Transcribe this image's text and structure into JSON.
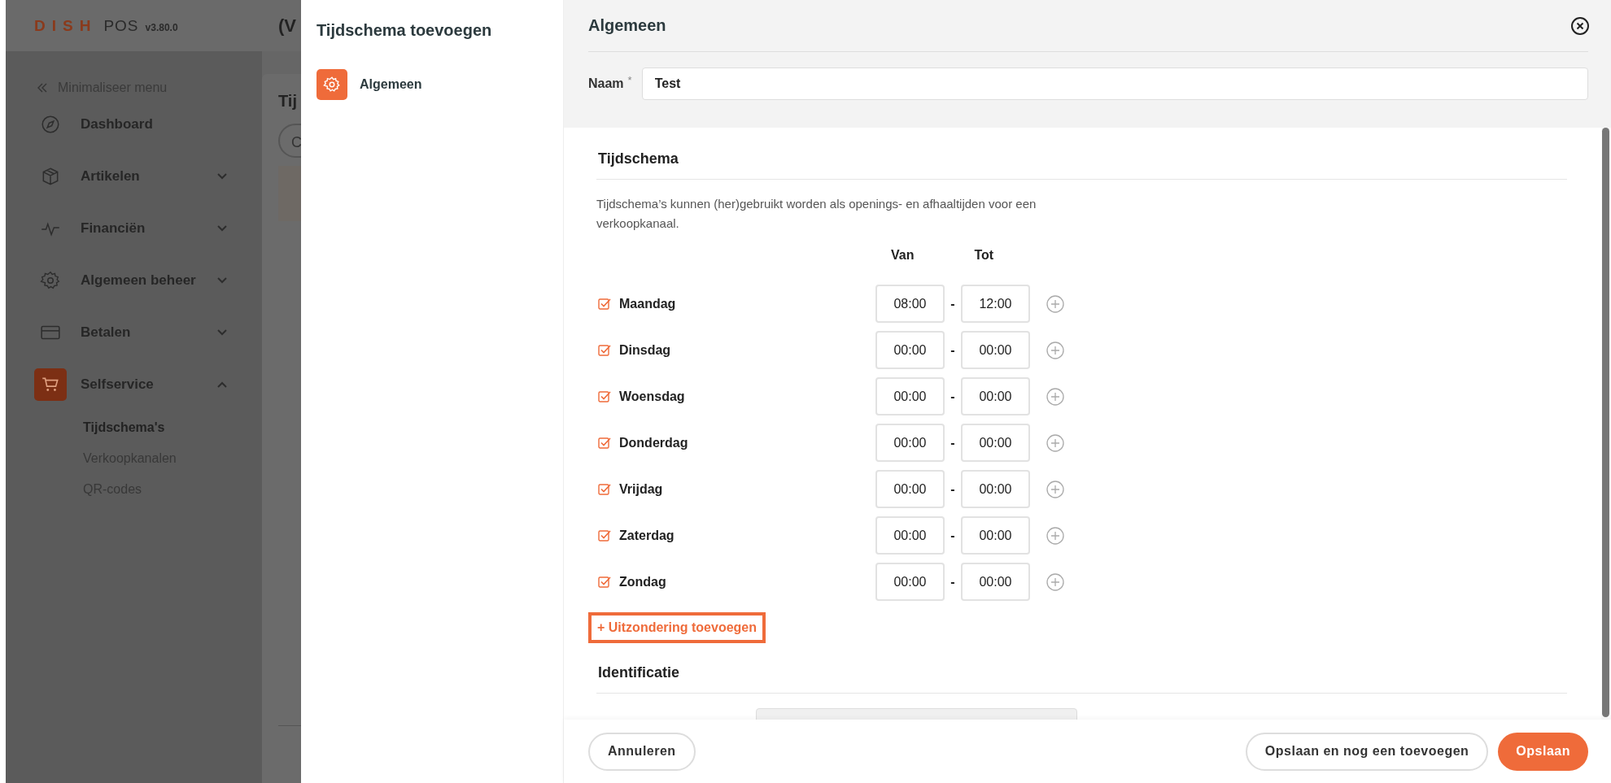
{
  "app": {
    "brand": "DISH",
    "product": "POS",
    "version": "v3.80.0",
    "header_cut": "(V"
  },
  "sidebar": {
    "minimize": "Minimaliseer menu",
    "items": [
      {
        "label": "Dashboard",
        "selected": false
      },
      {
        "label": "Artikelen",
        "expanded": false,
        "selected": false
      },
      {
        "label": "Financiën",
        "expanded": false,
        "selected": false
      },
      {
        "label": "Algemeen beheer",
        "expanded": false,
        "selected": false
      },
      {
        "label": "Betalen",
        "expanded": false,
        "selected": false
      },
      {
        "label": "Selfservice",
        "expanded": true,
        "selected": true,
        "children": [
          {
            "label": "Tijdschema's",
            "selected": true
          },
          {
            "label": "Verkoopkanalen",
            "selected": false
          },
          {
            "label": "QR-codes",
            "selected": false
          }
        ]
      }
    ]
  },
  "background_page": {
    "title_cut": "Tij",
    "button_cut": "C"
  },
  "modal": {
    "title": "Tijdschema toevoegen",
    "steps": [
      {
        "label": "Algemeen",
        "selected": true
      }
    ]
  },
  "form": {
    "section_title": "Algemeen",
    "name_label": "Naam",
    "required_mark": "*",
    "name_value": "Test",
    "schedule": {
      "title": "Tijdschema",
      "description": "Tijdschema’s kunnen (her)gebruikt worden als openings- en afhaaltijden voor een verkoopkanaal.",
      "columns": [
        "Van",
        "Tot"
      ],
      "days": [
        {
          "label": "Maandag",
          "checked": true,
          "from": "08:00",
          "separator": "-",
          "to": "12:00"
        },
        {
          "label": "Dinsdag",
          "checked": true,
          "from": "00:00",
          "separator": "-",
          "to": "00:00"
        },
        {
          "label": "Woensdag",
          "checked": true,
          "from": "00:00",
          "separator": "-",
          "to": "00:00"
        },
        {
          "label": "Donderdag",
          "checked": true,
          "from": "00:00",
          "separator": "-",
          "to": "00:00"
        },
        {
          "label": "Vrijdag",
          "checked": true,
          "from": "00:00",
          "separator": "-",
          "to": "00:00"
        },
        {
          "label": "Zaterdag",
          "checked": true,
          "from": "00:00",
          "separator": "-",
          "to": "00:00"
        },
        {
          "label": "Zondag",
          "checked": true,
          "from": "00:00",
          "separator": "-",
          "to": "00:00"
        }
      ],
      "exception_link": "+ Uitzondering toevoegen",
      "exception_highlighted": true
    },
    "identification_title": "Identificatie"
  },
  "footer": {
    "cancel": "Annuleren",
    "save_and_add": "Opslaan en nog een toevoegen",
    "save": "Opslaan"
  }
}
